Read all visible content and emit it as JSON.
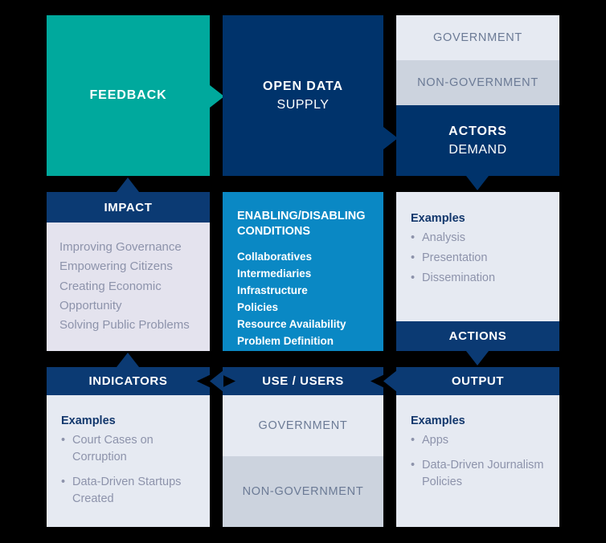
{
  "colors": {
    "background": "#000000",
    "teal": "#00a99d",
    "navy": "#00336b",
    "header_navy": "#0b3a73",
    "blue": "#0a88c4",
    "light_gray": "#e6eaf2",
    "mid_gray": "#ccd3de",
    "lavender": "#e4e3ee",
    "muted_text": "#8d93ab",
    "band_text": "#6b7a95"
  },
  "row1": {
    "feedback": {
      "label": "FEEDBACK"
    },
    "open_data": {
      "title": "OPEN DATA",
      "subtitle": "SUPPLY"
    },
    "actors": {
      "bands": [
        "GOVERNMENT",
        "NON-GOVERNMENT"
      ],
      "title": "ACTORS",
      "subtitle": "DEMAND"
    }
  },
  "row2": {
    "impact": {
      "header": "IMPACT",
      "items": [
        "Improving Governance",
        "Empowering Citizens",
        "Creating Economic",
        "Opportunity",
        "Solving Public Problems"
      ]
    },
    "conditions": {
      "title": "ENABLING/DISABLING CONDITIONS",
      "items": [
        "Collaboratives",
        "Intermediaries",
        "Infrastructure",
        "Policies",
        "Resource Availability",
        "Problem Definition"
      ]
    },
    "actions": {
      "examples_title": "Examples",
      "examples": [
        "Analysis",
        "Presentation",
        "Dissemination"
      ],
      "header": "ACTIONS"
    }
  },
  "row3": {
    "indicators": {
      "header": "INDICATORS",
      "examples_title": "Examples",
      "examples": [
        "Court Cases on Corruption",
        "Data-Driven Startups Created"
      ]
    },
    "use_users": {
      "header": "USE / USERS",
      "bands": [
        "GOVERNMENT",
        "NON-GOVERNMENT"
      ]
    },
    "output": {
      "header": "OUTPUT",
      "examples_title": "Examples",
      "examples": [
        "Apps",
        "Data-Driven Journalism Policies"
      ]
    }
  }
}
